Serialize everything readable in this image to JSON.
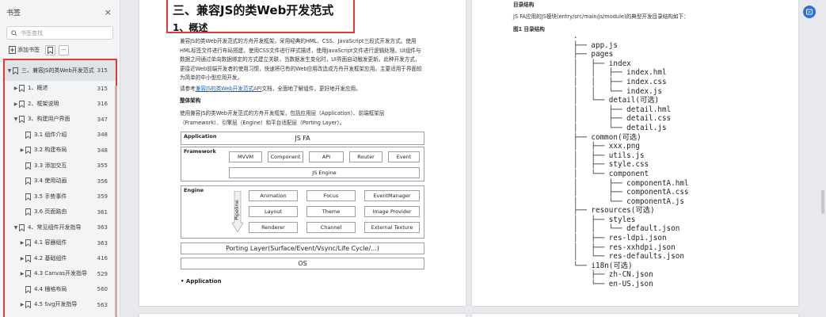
{
  "sidebar": {
    "title": "书签",
    "close": "×",
    "search_placeholder": "书签查找",
    "add_bookmark": "添加书签",
    "more": "···",
    "items": [
      {
        "label": "三、兼容JS的类Web开发范式",
        "page": "315",
        "arrow": "▼",
        "level": 0,
        "selected": true
      },
      {
        "label": "1、概述",
        "page": "315",
        "arrow": "▶",
        "level": 1
      },
      {
        "label": "2、框架说明",
        "page": "316",
        "arrow": "▶",
        "level": 1
      },
      {
        "label": "3、构建用户界面",
        "page": "347",
        "arrow": "▼",
        "level": 1
      },
      {
        "label": "3.1 组件介绍",
        "page": "348",
        "arrow": "",
        "level": 2
      },
      {
        "label": "3.2 构建布局",
        "page": "348",
        "arrow": "▶",
        "level": 2
      },
      {
        "label": "3.3 添加交互",
        "page": "355",
        "arrow": "",
        "level": 2
      },
      {
        "label": "3.4 使用动画",
        "page": "356",
        "arrow": "",
        "level": 2
      },
      {
        "label": "3.5 手势事件",
        "page": "359",
        "arrow": "",
        "level": 2
      },
      {
        "label": "3.6 页面路由",
        "page": "361",
        "arrow": "",
        "level": 2
      },
      {
        "label": "4、常见组件开发指导",
        "page": "363",
        "arrow": "▼",
        "level": 1
      },
      {
        "label": "4.1 容器组件",
        "page": "363",
        "arrow": "▶",
        "level": 2
      },
      {
        "label": "4.2 基础组件",
        "page": "416",
        "arrow": "▶",
        "level": 2
      },
      {
        "label": "4.3 Canvas开发指导",
        "page": "529",
        "arrow": "▶",
        "level": 2
      },
      {
        "label": "4.4 栅格布局",
        "page": "560",
        "arrow": "",
        "level": 2
      },
      {
        "label": "4.5 Svg开发指导",
        "page": "563",
        "arrow": "▶",
        "level": 2
      }
    ]
  },
  "left_page": {
    "h1": "三、兼容JS的类Web开发范式",
    "h2": "1、概述",
    "p1": "兼容JS的类Web开发范式的方舟开发框架，采用经典的HML、CSS、JavaScript三段式开发方式。使用HML标签文件进行布局搭建，使用CSS文件进行样式描述，使用JavaScript文件进行逻辑处理。UI组件与数据之间通过单向数据绑定的方式建立关联，当数据发生变化时，UI界面自动触发更新。此种开发方式，更接近Web前端开发者的使用习惯，快速将已有的Web应用改造成方舟开发框架应用。主要适用于界面较为简单的中小型应用开发。",
    "p2_pre": "请参考",
    "p2_link": "兼容JS的类Web开发范式API",
    "p2_post": "文档，全面地了解组件，更好地开发应用。",
    "p3": "整体架构",
    "p4": "使用兼容JS的类Web开发范式的方舟开发框架，包括应用层（Application）、前端框架层（Framework）、引擎层（Engine）和平台适配层（Porting Layer）。",
    "bullet": "Application",
    "arch": {
      "application": "Application",
      "js_fa": "JS FA",
      "framework": "Framework",
      "fw_boxes": [
        "MVVM",
        "Component",
        "API",
        "Router",
        "Event"
      ],
      "js_engine": "JS Engine",
      "engine": "Engine",
      "pipeline": "Pipeline",
      "eng_boxes": [
        "Animation",
        "Focus",
        "EventManager",
        "Layout",
        "Theme",
        "Image Provider",
        "Renderer",
        "Channel",
        "External Texture"
      ],
      "porting": "Porting Layer(Surface/Event/Vsync/Life Cycle/...)",
      "os": "OS"
    }
  },
  "right_page": {
    "t1": "目录结构",
    "t2": "JS FA应用的JS模块(entry/src/main/js/module)的典型开发目录结构如下：",
    "t3": "图1 目录结构",
    "tree": [
      ".",
      "├── app.js",
      "├── pages",
      "│   ├── index",
      "│   │   ├── index.hml",
      "│   │   ├── index.css",
      "│   │   └── index.js",
      "│   └── detail(可选)",
      "│       ├── detail.hml",
      "│       ├── detail.css",
      "│       └── detail.js",
      "├── common(可选)",
      "│   ├── xxx.png",
      "│   ├── utils.js",
      "│   ├── style.css",
      "│   └── component",
      "│       ├── componentA.hml",
      "│       ├── componentA.css",
      "│       └── componentA.js",
      "├── resources(可选)",
      "│   ├── styles",
      "│   │   └── default.json",
      "│   ├── res-ldpi.json",
      "│   ├── res-xxhdpi.json",
      "│   └── res-defaults.json",
      "└── i18n(可选)",
      "    ├── zh-CN.json",
      "    └── en-US.json"
    ]
  },
  "colors": {
    "highlight": "#e53935",
    "link": "#1a5fb4",
    "accent": "#2f6fd6"
  }
}
